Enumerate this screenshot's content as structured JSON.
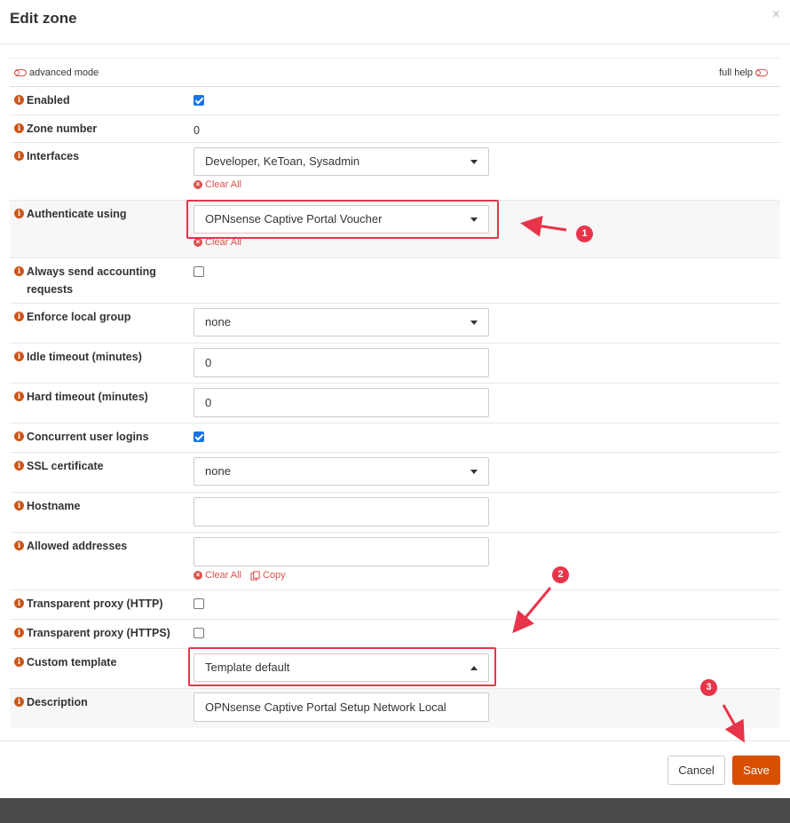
{
  "modal": {
    "title": "Edit zone",
    "close_label": "×"
  },
  "toggles": {
    "advanced_mode": "advanced mode",
    "full_help": "full help"
  },
  "fields": {
    "enabled": {
      "label": "Enabled",
      "checked": true
    },
    "zone_number": {
      "label": "Zone number",
      "value": "0"
    },
    "interfaces": {
      "label": "Interfaces",
      "value": "Developer, KeToan, Sysadmin",
      "clear_label": "Clear All"
    },
    "authenticate": {
      "label": "Authenticate using",
      "value": "OPNsense Captive Portal Voucher",
      "clear_label": "Clear All"
    },
    "accounting": {
      "label": "Always send accounting requests",
      "checked": false
    },
    "local_group": {
      "label": "Enforce local group",
      "value": "none"
    },
    "idle_timeout": {
      "label": "Idle timeout (minutes)",
      "value": "0"
    },
    "hard_timeout": {
      "label": "Hard timeout (minutes)",
      "value": "0"
    },
    "concurrent": {
      "label": "Concurrent user logins",
      "checked": true
    },
    "ssl_cert": {
      "label": "SSL certificate",
      "value": "none"
    },
    "hostname": {
      "label": "Hostname",
      "value": ""
    },
    "allowed_addresses": {
      "label": "Allowed addresses",
      "value": "",
      "clear_label": "Clear All",
      "copy_label": "Copy"
    },
    "proxy_http": {
      "label": "Transparent proxy (HTTP)",
      "checked": false
    },
    "proxy_https": {
      "label": "Transparent proxy (HTTPS)",
      "checked": false
    },
    "custom_template": {
      "label": "Custom template",
      "value": "Template default"
    },
    "description": {
      "label": "Description",
      "value": "OPNsense Captive Portal Setup Network Local"
    }
  },
  "annotations": {
    "badge1": "1",
    "badge2": "2",
    "badge3": "3",
    "accent": "#e8344a"
  },
  "footer": {
    "cancel_label": "Cancel",
    "save_label": "Save",
    "save_color": "#d94f00"
  }
}
